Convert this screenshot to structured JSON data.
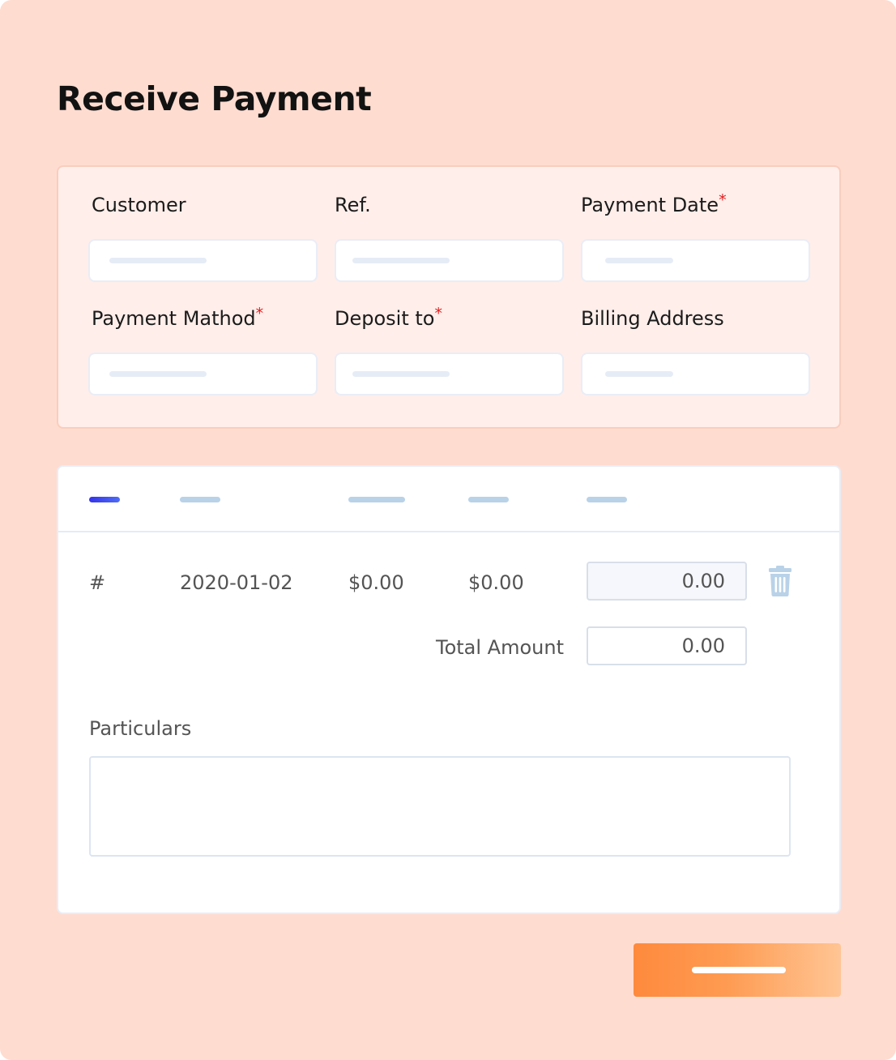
{
  "page": {
    "title": "Receive Payment"
  },
  "form": {
    "customer_label": "Customer",
    "ref_label": "Ref.",
    "payment_date_label": "Payment Date",
    "payment_method_label": "Payment Mathod",
    "deposit_to_label": "Deposit to",
    "billing_address_label": "Billing Address",
    "required_marker": "*"
  },
  "table": {
    "row": {
      "number": "#",
      "date": "2020-01-02",
      "amount_1": "$0.00",
      "amount_2": "$0.00",
      "payment": "0.00"
    },
    "total_label": "Total Amount",
    "total_value": "0.00",
    "particulars_label": "Particulars",
    "delete_icon": "trash-icon"
  },
  "colors": {
    "background": "#ffdcd0",
    "accent_active_tab": "#3433ea",
    "submit_gradient_start": "#fe8a3d",
    "submit_gradient_end": "#ffc594",
    "required_asterisk": "#e21b1b"
  }
}
